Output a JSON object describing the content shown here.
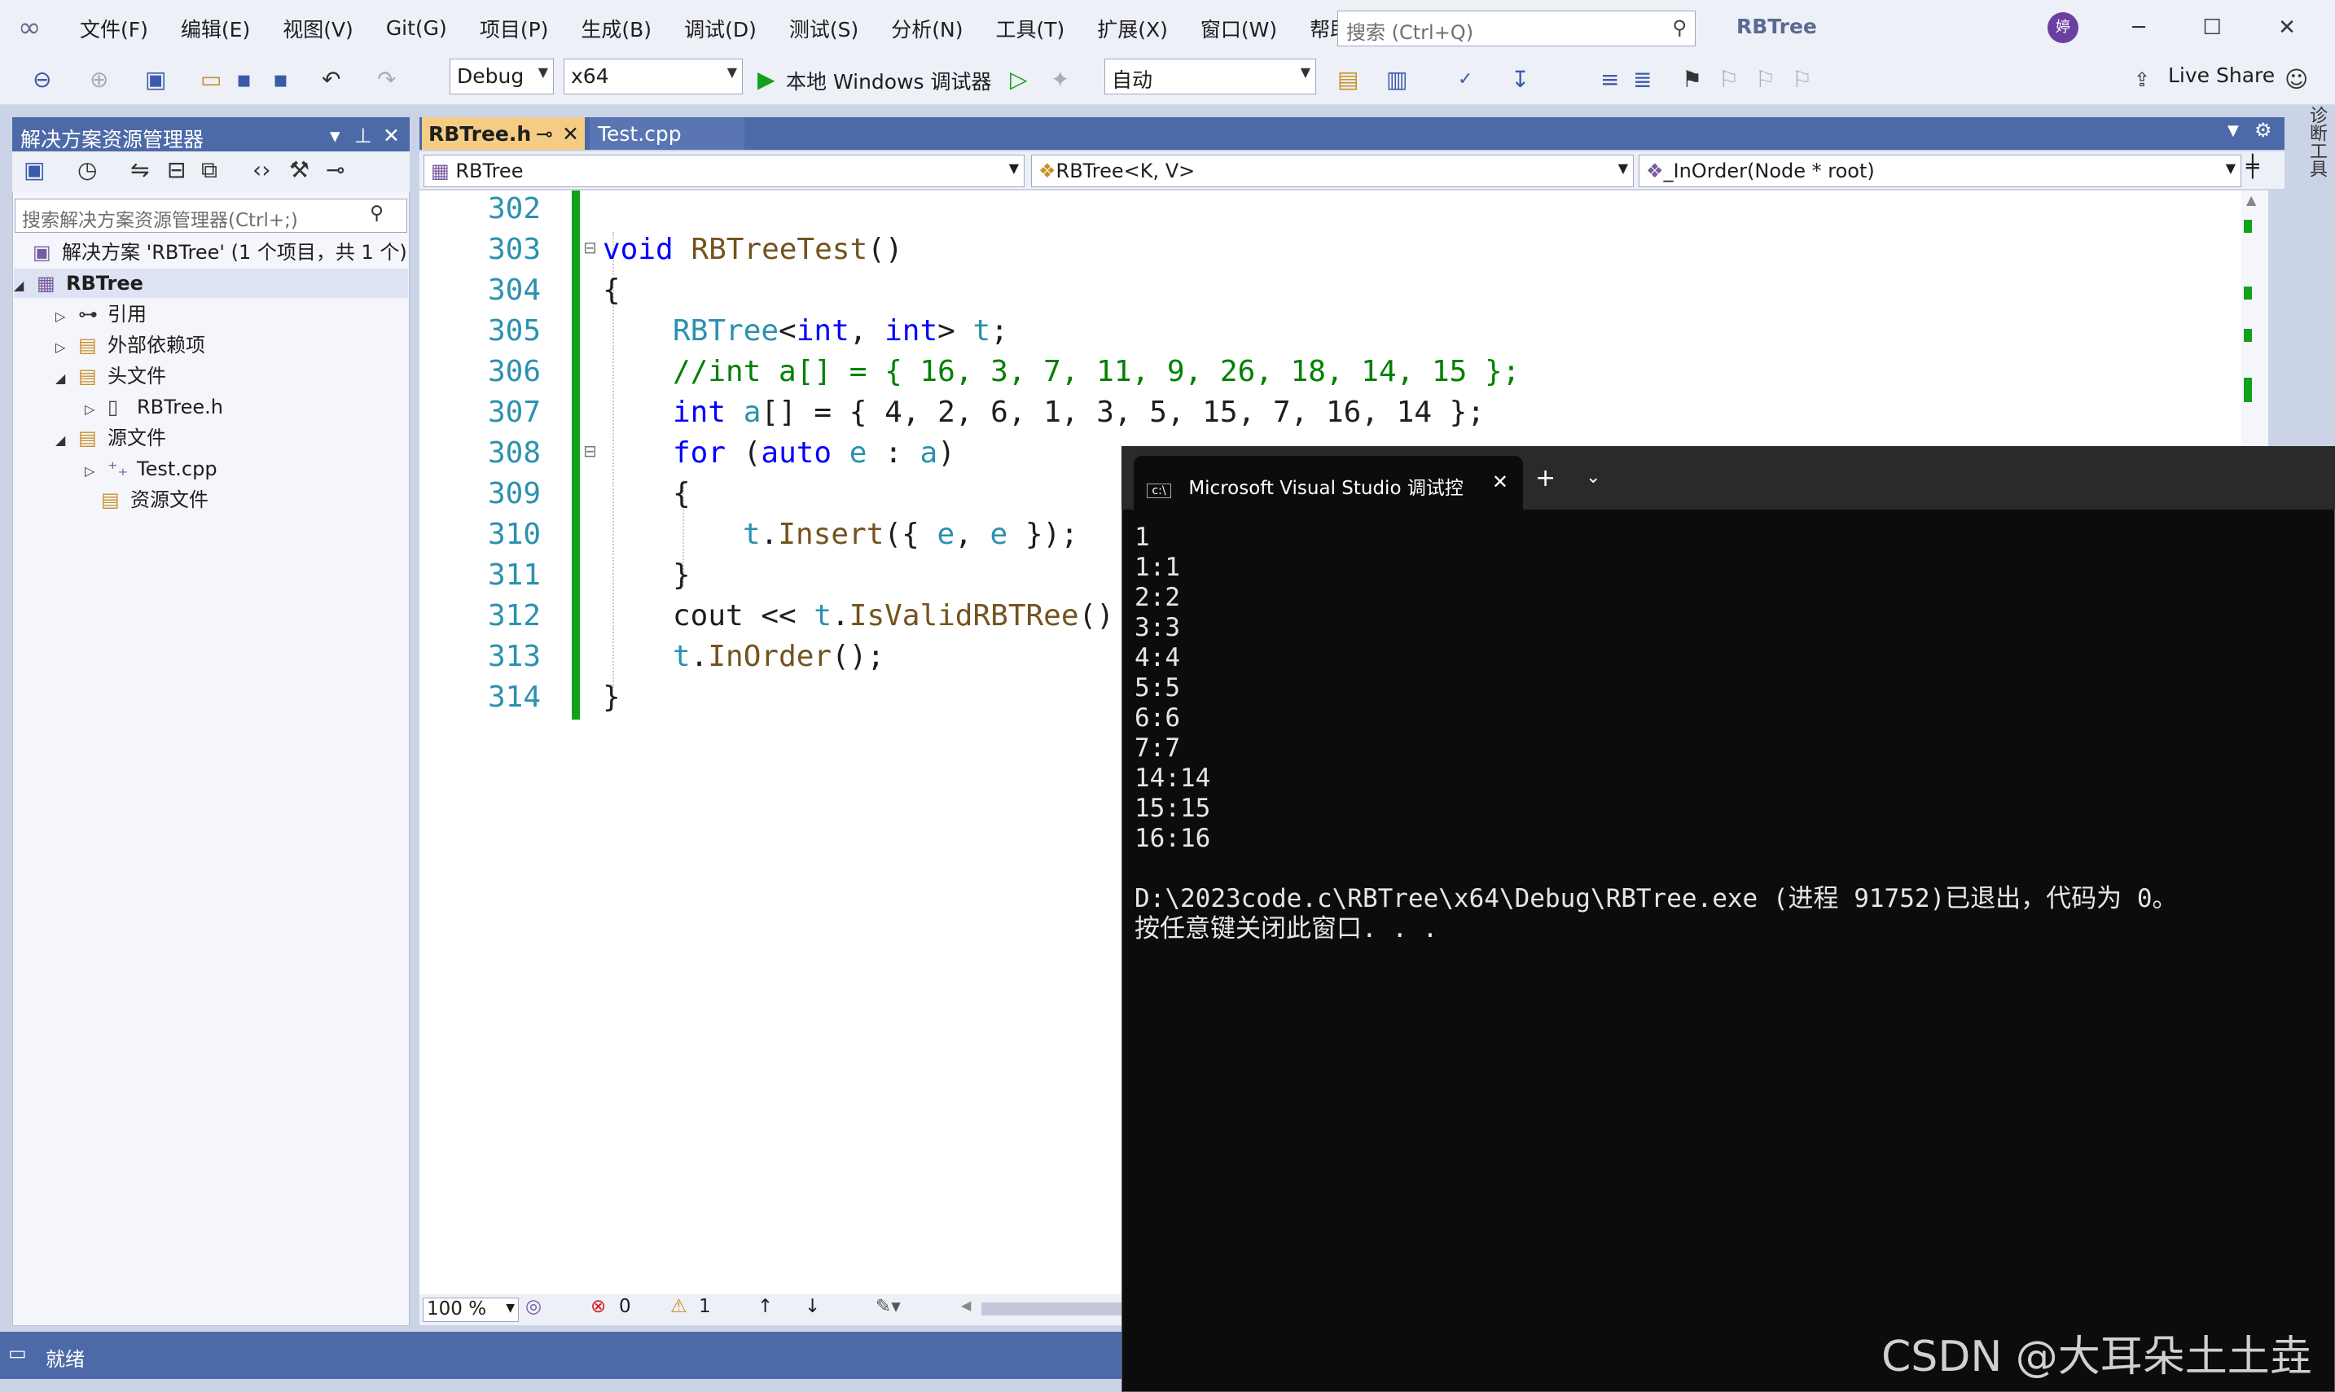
{
  "menu": [
    "文件(F)",
    "编辑(E)",
    "视图(V)",
    "Git(G)",
    "项目(P)",
    "生成(B)",
    "调试(D)",
    "测试(S)",
    "分析(N)",
    "工具(T)",
    "扩展(X)",
    "窗口(W)",
    "帮助(H)"
  ],
  "search": {
    "placeholder": "搜索 (Ctrl+Q)"
  },
  "app_title": "RBTree",
  "avatar_text": "婷",
  "toolbar": {
    "config": "Debug",
    "platform": "x64",
    "run_label": "本地 Windows 调试器",
    "auto": "自动",
    "live_share": "Live Share"
  },
  "solution_explorer": {
    "title": "解决方案资源管理器",
    "search_placeholder": "搜索解决方案资源管理器(Ctrl+;)",
    "items": [
      {
        "label": "解决方案 'RBTree' (1 个项目，共 1 个)"
      },
      {
        "label": "RBTree"
      },
      {
        "label": "引用"
      },
      {
        "label": "外部依赖项"
      },
      {
        "label": "头文件"
      },
      {
        "label": "RBTree.h"
      },
      {
        "label": "源文件"
      },
      {
        "label": "Test.cpp"
      },
      {
        "label": "资源文件"
      }
    ]
  },
  "tabs": {
    "active": "RBTree.h",
    "second": "Test.cpp"
  },
  "nav": {
    "scope": "RBTree",
    "type": "RBTree<K, V>",
    "member": "_InOrder(Node * root)"
  },
  "editor": {
    "line_numbers": [
      "302",
      "303",
      "304",
      "305",
      "306",
      "307",
      "308",
      "309",
      "310",
      "311",
      "312",
      "313",
      "314"
    ],
    "zoom": "100 %",
    "errors": "0",
    "warnings": "1"
  },
  "right_panel": "诊断工具",
  "status": {
    "text": "就绪"
  },
  "console": {
    "tab_title": "Microsoft Visual Studio 调试控",
    "output": "1\n1:1\n2:2\n3:3\n4:4\n5:5\n6:6\n7:7\n14:14\n15:15\n16:16\n\nD:\\2023code.c\\RBTree\\x64\\Debug\\RBTree.exe (进程 91752)已退出，代码为 0。\n按任意键关闭此窗口. . ."
  },
  "watermark": "CSDN @大耳朵土土垚"
}
